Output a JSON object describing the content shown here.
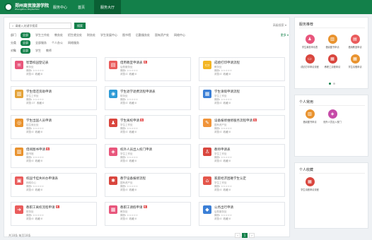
{
  "header": {
    "logo_cn": "郑州商贸旅游学院",
    "logo_en": "Zhengzhou Polytechnic",
    "system_name": "服务中心",
    "tabs": [
      {
        "label": "首页",
        "active": false
      },
      {
        "label": "服务大厅",
        "active": true
      }
    ],
    "colors": {
      "brand": "#13804a",
      "brand_dark": "#0a5f34"
    }
  },
  "search": {
    "placeholder": "请输入关键字搜索",
    "button_label": "搜索",
    "advanced_label": "高级搜索 ▾"
  },
  "filters": [
    {
      "label": "部门",
      "items": [
        {
          "text": "全部",
          "selected": true
        },
        {
          "text": "学生工作处",
          "selected": false
        },
        {
          "text": "教务处",
          "selected": false
        },
        {
          "text": "招生就业处",
          "selected": false
        },
        {
          "text": "财务处",
          "selected": false
        },
        {
          "text": "学生发展中心",
          "selected": false
        },
        {
          "text": "图书馆",
          "selected": false
        },
        {
          "text": "后勤服务处",
          "selected": false
        },
        {
          "text": "国有资产处",
          "selected": false
        },
        {
          "text": "网络中心",
          "selected": false
        }
      ],
      "more": "更多 ▾"
    },
    {
      "label": "分类",
      "items": [
        {
          "text": "全部",
          "selected": true
        },
        {
          "text": "全部服务",
          "selected": false
        },
        {
          "text": "个人办公",
          "selected": false
        },
        {
          "text": "网络服务",
          "selected": false
        }
      ]
    },
    {
      "label": "对象",
      "items": [
        {
          "text": "全部",
          "selected": true
        },
        {
          "text": "学生",
          "selected": false
        },
        {
          "text": "教师",
          "selected": false
        }
      ]
    }
  ],
  "cards": [
    {
      "title": "智慧校园登记表",
      "hot": false,
      "icon": "list-icon",
      "color": "#e8567c",
      "dept": "教务处",
      "score": "评分: ☆☆☆☆☆",
      "views": "0",
      "fav": "0"
    },
    {
      "title": "借用教室申请表",
      "hot": true,
      "icon": "doc-icon",
      "color": "#ea5c5c",
      "dept": "后勤服务处",
      "score": "评分: ☆☆☆☆☆",
      "views": "0",
      "fav": "0"
    },
    {
      "title": "成绩打印申请流程",
      "hot": false,
      "icon": "folder-icon",
      "color": "#f3b624",
      "dept": "教务处",
      "score": "评分: ☆☆☆☆☆",
      "views": "0",
      "fav": "0"
    },
    {
      "title": "学生借还资助申请",
      "hot": false,
      "icon": "book-icon",
      "color": "#e4a33a",
      "dept": "学生工作处",
      "score": "评分: ☆☆☆☆☆",
      "views": "17",
      "fav": "0"
    },
    {
      "title": "学生退学退费流程申请表",
      "hot": false,
      "icon": "user-icon",
      "color": "#2e9bd6",
      "dept": "财务处",
      "score": "评分: ☆☆☆☆☆",
      "views": "0",
      "fav": "0"
    },
    {
      "title": "学生请假申请流程",
      "hot": false,
      "icon": "clipboard-icon",
      "color": "#3b7fd6",
      "dept": "学生工作处",
      "score": "评分: ☆☆☆☆☆",
      "views": "0",
      "fav": "0"
    },
    {
      "title": "学生出国人员申请",
      "hot": false,
      "icon": "globe-icon",
      "color": "#e9932f",
      "dept": "招生就业处",
      "score": "评分: ☆☆☆☆☆",
      "views": "0",
      "fav": "0"
    },
    {
      "title": "学生离校申请",
      "hot": true,
      "icon": "person-icon",
      "color": "#d9463e",
      "dept": "学生工作处",
      "score": "评分: ☆☆☆☆☆",
      "views": "0",
      "fav": "0"
    },
    {
      "title": "设备报修维修服务流程申请",
      "hot": true,
      "icon": "wrench-icon",
      "color": "#f0943a",
      "dept": "国有资产处",
      "score": "评分: ☆☆☆☆☆",
      "views": "0",
      "fav": "0"
    },
    {
      "title": "借阅图书申请",
      "hot": true,
      "icon": "book-icon",
      "color": "#e9932f",
      "dept": "图书馆",
      "score": "评分: ☆☆☆☆☆",
      "views": "0",
      "fav": "0"
    },
    {
      "title": "校外人员出入校门申请",
      "hot": false,
      "icon": "badge-icon",
      "color": "#e8567c",
      "dept": "学生工作处",
      "score": "评分: ☆☆☆☆☆",
      "views": "0",
      "fav": "0"
    },
    {
      "title": "教师申请表",
      "hot": false,
      "icon": "teacher-icon",
      "color": "#d9463e",
      "dept": "学生工作处",
      "score": "评分: ☆☆☆☆☆",
      "views": "0",
      "fav": "0"
    },
    {
      "title": "校园卡挂失补办申请表",
      "hot": false,
      "icon": "card-icon",
      "color": "#ea5c5c",
      "dept": "网络中心",
      "score": "评分: ☆☆☆☆☆",
      "views": "0",
      "fav": "0"
    },
    {
      "title": "教学设备报修流程",
      "hot": false,
      "icon": "gear-icon",
      "color": "#d9463e",
      "dept": "国有资产处",
      "score": "评分: ☆☆☆☆☆",
      "views": "0",
      "fav": "0"
    },
    {
      "title": "家庭经济困难学生认定",
      "hot": false,
      "icon": "home-icon",
      "color": "#e4564b",
      "dept": "学生工作处",
      "score": "评分: ☆☆☆☆☆",
      "views": "0",
      "fav": "0"
    },
    {
      "title": "教职工离校流程申请",
      "hot": true,
      "icon": "exit-icon",
      "color": "#ea5c5c",
      "dept": "财务处",
      "score": "评分: ☆☆☆☆☆",
      "views": "0",
      "fav": "0"
    },
    {
      "title": "教职工请假申请",
      "hot": true,
      "icon": "calendar-icon",
      "color": "#e8567c",
      "dept": "教务处",
      "score": "评分: ☆☆☆☆☆",
      "views": "0",
      "fav": "0"
    },
    {
      "title": "公务出行申请",
      "hot": false,
      "icon": "car-icon",
      "color": "#3b7fd6",
      "dept": "后勤服务处",
      "score": "评分: ☆☆☆☆☆",
      "views": "0",
      "fav": "0"
    }
  ],
  "card_labels": {
    "views_prefix": "浏览:",
    "fav_prefix": "收藏:"
  },
  "pagination": {
    "total": "共18条 每页18条",
    "pages": [
      "‹",
      "1",
      "›"
    ],
    "current": "1"
  },
  "sidebar": {
    "recommend": {
      "title": "服务推荐",
      "apps": [
        {
          "label": "学生离校申请表",
          "icon": "person-icon",
          "color": "#e8567c"
        },
        {
          "label": "借阅图书申请",
          "icon": "book-icon",
          "color": "#e9932f"
        },
        {
          "label": "借用教室申请",
          "icon": "doc-icon",
          "color": "#ea5c5c"
        },
        {
          "label": "成绩打印申请流程",
          "icon": "folder-icon",
          "color": "#d9463e"
        },
        {
          "label": "教职工请假申请",
          "icon": "calendar-icon",
          "color": "#d9463e"
        },
        {
          "label": "学生请假申请",
          "icon": "clipboard-icon",
          "color": "#e9932f"
        }
      ]
    },
    "personal_apps": {
      "title": "个人常用",
      "apps": [
        {
          "label": "借阅图书申请",
          "icon": "book-icon",
          "color": "#e9932f"
        },
        {
          "label": "校外人员出入校门",
          "icon": "badge-icon",
          "color": "#c64aa8"
        }
      ]
    },
    "personal_fav": {
      "title": "个人收藏",
      "apps": [
        {
          "label": "学生请假申请流程",
          "icon": "clipboard-icon",
          "color": "#d9463e"
        }
      ]
    }
  }
}
